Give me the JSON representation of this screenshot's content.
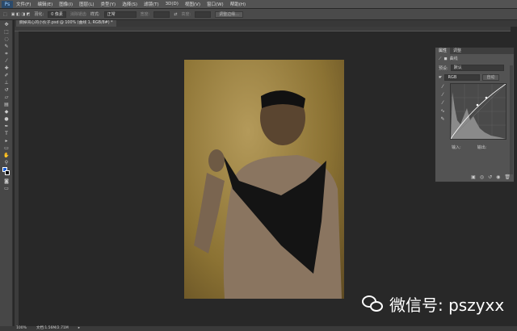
{
  "app": {
    "logo": "Ps"
  },
  "menu": [
    "文件(F)",
    "编辑(E)",
    "图像(I)",
    "图层(L)",
    "类型(Y)",
    "选择(S)",
    "滤镜(T)",
    "3D(D)",
    "视图(V)",
    "窗口(W)",
    "帮助(H)"
  ],
  "options": {
    "feather_label": "羽化:",
    "feather_value": "0 像素",
    "antialias": "消除锯齿",
    "style_label": "样式:",
    "style_value": "正常",
    "width_label": "宽度:",
    "height_label": "高度:",
    "refine_edge": "调整边缘..."
  },
  "document_tab": "撕掉背心的小伙子.psd @ 100% (曲线 1, RGB/8#) *",
  "panel": {
    "tabs": [
      "属性",
      "调整"
    ],
    "title": "曲线",
    "preset_label": "预设:",
    "preset_value": "默认",
    "channel_value": "RGB",
    "auto_button": "自动",
    "input_label": "输入:",
    "output_label": "输出:"
  },
  "status": {
    "zoom": "100%",
    "doc_info": "文档:1.56M/2.71M"
  },
  "watermark": "微信号: pszyxx",
  "colors": {
    "bg": "#282828",
    "panel": "#535353",
    "accent": "#2b4a6b"
  }
}
